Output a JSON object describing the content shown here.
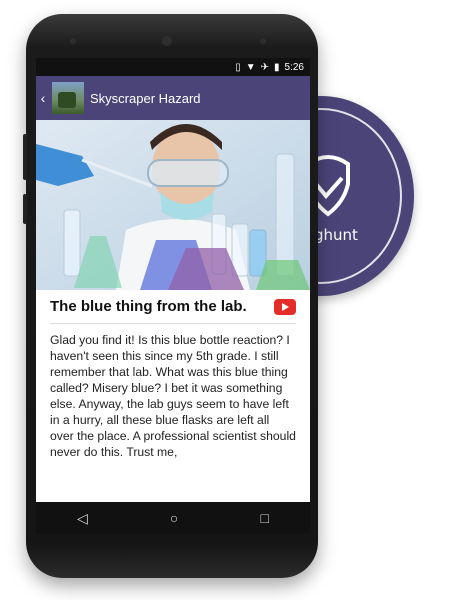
{
  "badge": {
    "brand_text": "ghunt"
  },
  "status_bar": {
    "time": "5:26",
    "icons": [
      "vibrate-icon",
      "wifi-icon",
      "airplane-icon",
      "battery-icon"
    ]
  },
  "app_bar": {
    "title": "Skyscraper Hazard",
    "back_icon": "chevron-left-icon"
  },
  "hero": {
    "description": "scientist-lab-photo"
  },
  "article": {
    "title": "The blue thing from the lab.",
    "youtube_icon": "youtube-icon",
    "body": "Glad you find it! Is this blue bottle reaction? I haven't seen this since my 5th grade. I still remember that lab. What was this blue thing called? Misery blue? I bet it was something else. Anyway, the lab guys seem to have left in a hurry, all these blue flasks are left all over the place. A professional scientist should never do this. Trust me,"
  },
  "nav_bar": {
    "back": "◁",
    "home": "○",
    "recents": "□"
  },
  "colors": {
    "brand": "#4b4478",
    "youtube": "#e52d27"
  }
}
